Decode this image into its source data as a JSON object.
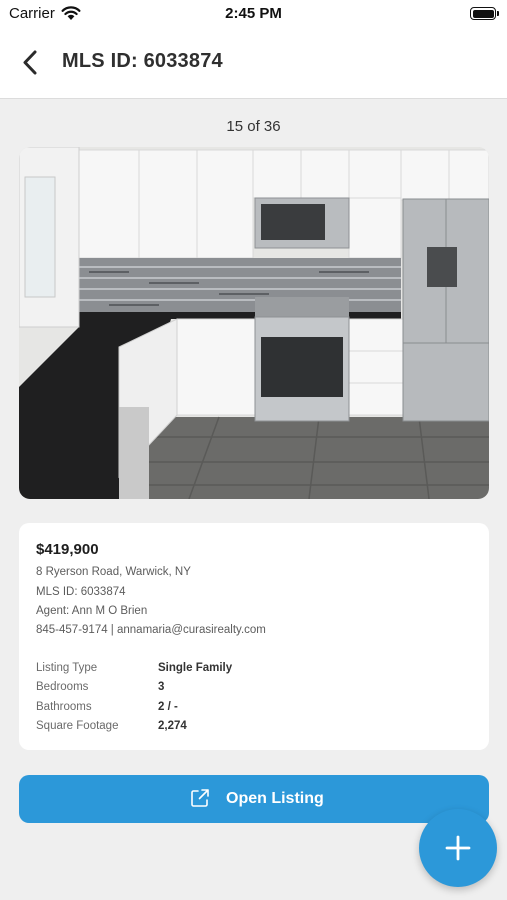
{
  "status_bar": {
    "carrier": "Carrier",
    "time": "2:45 PM"
  },
  "nav": {
    "title": "MLS ID: 6033874",
    "back_icon": "chevron-left-icon"
  },
  "gallery": {
    "counter": "15 of 36",
    "photo_subject": "kitchen"
  },
  "listing": {
    "price": "$419,900",
    "address": "8 Ryerson Road, Warwick, NY",
    "mls_id": "MLS ID: 6033874",
    "agent": "Agent: Ann M O Brien",
    "contact": "845-457-9174  |  annamaria@curasirealty.com",
    "specs": [
      {
        "label": "Listing Type",
        "value": "Single Family"
      },
      {
        "label": "Bedrooms",
        "value": "3"
      },
      {
        "label": "Bathrooms",
        "value": "2 / -"
      },
      {
        "label": "Square Footage",
        "value": "2,274"
      }
    ]
  },
  "actions": {
    "open_listing_label": "Open Listing",
    "open_listing_icon": "external-link-icon",
    "fab_icon": "plus-icon"
  },
  "colors": {
    "accent": "#2c98d9",
    "background": "#efefef",
    "card": "#ffffff"
  }
}
